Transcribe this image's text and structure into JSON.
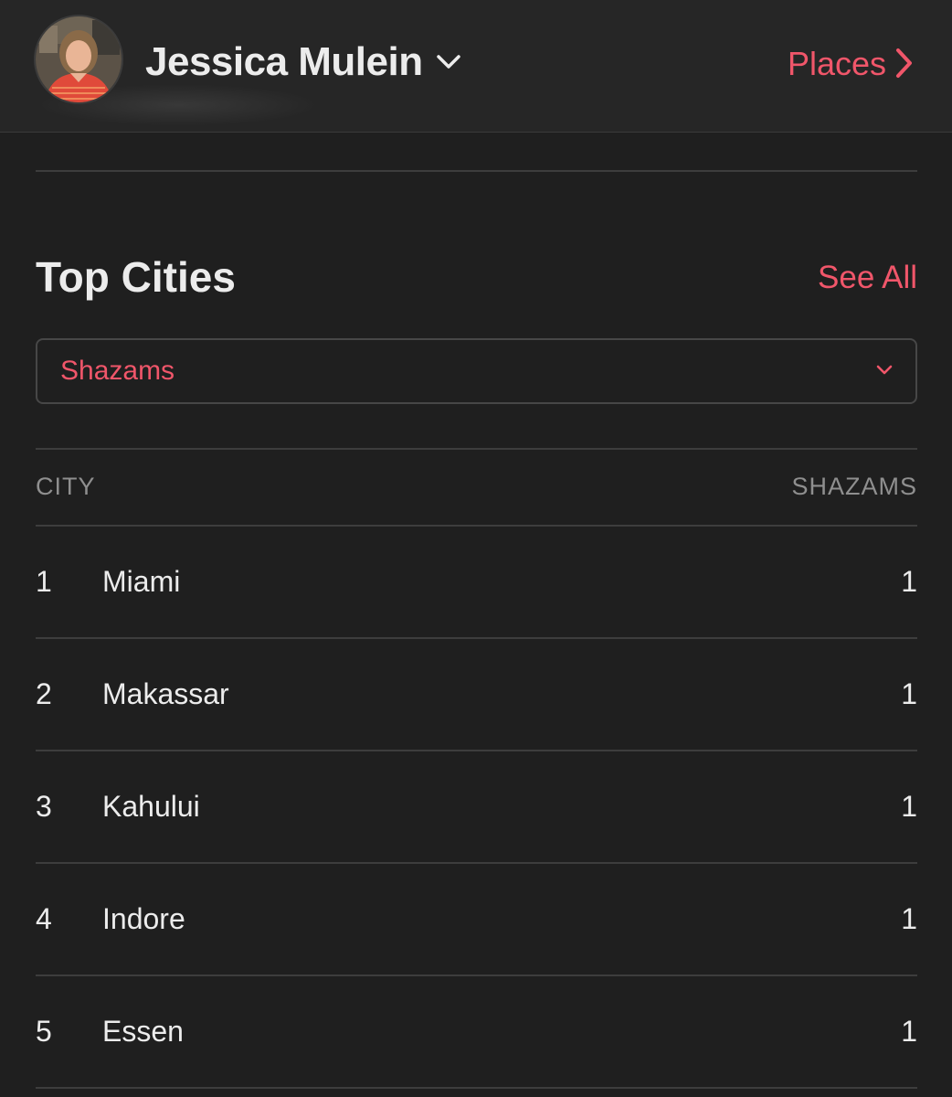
{
  "header": {
    "user_name": "Jessica Mulein",
    "places_label": "Places",
    "avatar_icon": "profile-photo"
  },
  "section": {
    "title": "Top Cities",
    "see_all_label": "See All"
  },
  "filter": {
    "selected": "Shazams"
  },
  "table": {
    "columns": [
      "CITY",
      "SHAZAMS"
    ],
    "rows": [
      {
        "rank": "1",
        "city": "Miami",
        "count": "1"
      },
      {
        "rank": "2",
        "city": "Makassar",
        "count": "1"
      },
      {
        "rank": "3",
        "city": "Kahului",
        "count": "1"
      },
      {
        "rank": "4",
        "city": "Indore",
        "count": "1"
      },
      {
        "rank": "5",
        "city": "Essen",
        "count": "1"
      }
    ]
  },
  "colors": {
    "background": "#1f1f1f",
    "header_background": "#262626",
    "accent": "#f0566a",
    "text": "#ececec",
    "muted_text": "#8f8f8f",
    "divider": "#3d3d3d"
  }
}
